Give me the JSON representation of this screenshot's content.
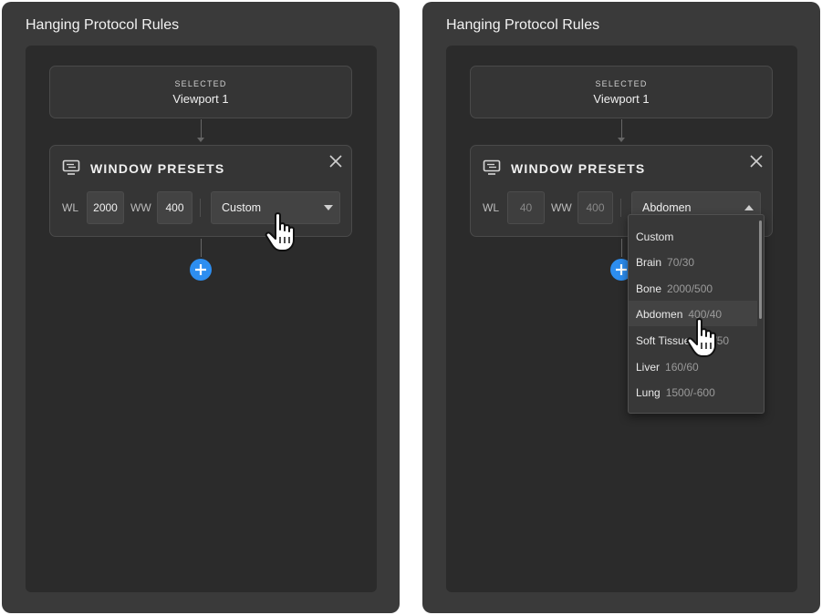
{
  "panels": [
    {
      "title": "Hanging Protocol Rules",
      "selected": {
        "label": "SELECTED",
        "value": "Viewport 1"
      },
      "presets": {
        "title": "WINDOW PRESETS",
        "wl_label": "WL",
        "wl_value": "2000",
        "ww_label": "WW",
        "ww_value": "400",
        "selected_option": "Custom",
        "dropdown_open": false
      }
    },
    {
      "title": "Hanging Protocol Rules",
      "selected": {
        "label": "SELECTED",
        "value": "Viewport 1"
      },
      "presets": {
        "title": "WINDOW PRESETS",
        "wl_label": "WL",
        "wl_value": "40",
        "ww_label": "WW",
        "ww_value": "400",
        "selected_option": "Abdomen",
        "dropdown_open": true,
        "options": [
          {
            "name": "Custom",
            "value": ""
          },
          {
            "name": "Brain",
            "value": "70/30"
          },
          {
            "name": "Bone",
            "value": "2000/500"
          },
          {
            "name": "Abdomen",
            "value": "400/40"
          },
          {
            "name": "Soft Tissue",
            "value": "400/50"
          },
          {
            "name": "Liver",
            "value": "160/60"
          },
          {
            "name": "Lung",
            "value": "1500/-600"
          }
        ],
        "hovered_option": "Abdomen"
      }
    }
  ],
  "colors": {
    "accent": "#2d8ef0",
    "panel": "#3a3a3a",
    "inner": "#2b2b2b",
    "card": "#353535"
  },
  "icons": [
    "monitor-icon",
    "close-icon",
    "chevron-down-icon",
    "chevron-up-icon",
    "plus-icon",
    "hand-pointer-icon"
  ]
}
